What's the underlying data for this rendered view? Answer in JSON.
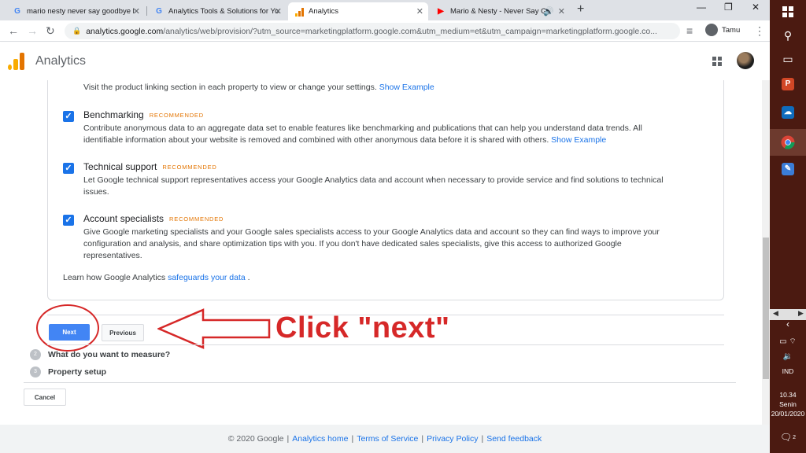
{
  "browser": {
    "tabs": [
      {
        "title": "mario nesty never say goodbye l",
        "favicon": "google-icon",
        "active": false
      },
      {
        "title": "Analytics Tools & Solutions for Yo",
        "favicon": "google-icon",
        "active": false
      },
      {
        "title": "Analytics",
        "favicon": "analytics-icon",
        "active": true
      },
      {
        "title": "Mario & Nesty - Never Say G",
        "favicon": "youtube-icon",
        "active": false
      }
    ],
    "new_tab": "+",
    "url_host": "analytics.google.com",
    "url_path": "/analytics/web/provision/?utm_source=marketingplatform.google.com&utm_medium=et&utm_campaign=marketingplatform.google.co...",
    "profile_name": "Tamu"
  },
  "header": {
    "title": "Analytics"
  },
  "settings": {
    "linking_desc": "Visit the product linking section in each property to view or change your settings.",
    "show_example": "Show Example",
    "options": [
      {
        "title": "Benchmarking",
        "badge": "RECOMMENDED",
        "desc": "Contribute anonymous data to an aggregate data set to enable features like benchmarking and publications that can help you understand data trends. All identifiable information about your website is removed and combined with other anonymous data before it is shared with others.",
        "link": "Show Example",
        "checked": true
      },
      {
        "title": "Technical support",
        "badge": "RECOMMENDED",
        "desc": "Let Google technical support representatives access your Google Analytics data and account when necessary to provide service and find solutions to technical issues.",
        "link": "",
        "checked": true
      },
      {
        "title": "Account specialists",
        "badge": "RECOMMENDED",
        "desc": "Give Google marketing specialists and your Google sales specialists access to your Google Analytics data and account so they can find ways to improve your configuration and analysis, and share optimization tips with you. If you don't have dedicated sales specialists, give this access to authorized Google representatives.",
        "link": "",
        "checked": true
      }
    ],
    "learn_prefix": "Learn how Google Analytics",
    "learn_link": "safeguards your data",
    "learn_suffix": "."
  },
  "buttons": {
    "next": "Next",
    "previous": "Previous",
    "cancel": "Cancel"
  },
  "annotation": {
    "text": "Click \"next\"",
    "color": "#d62828"
  },
  "steps": [
    {
      "num": "2",
      "label": "What do you want to measure?"
    },
    {
      "num": "3",
      "label": "Property setup"
    }
  ],
  "footer": {
    "copyright": "© 2020 Google",
    "links": [
      "Analytics home",
      "Terms of Service",
      "Privacy Policy",
      "Send feedback"
    ]
  },
  "taskbar": {
    "language": "IND",
    "time": "10.34",
    "day": "Senin",
    "date": "20/01/2020",
    "notification_count": "2"
  },
  "colors": {
    "accent": "#1a73e8",
    "next_button": "#4285f4",
    "recommended": "#e37400",
    "taskbar": "#4b1a11"
  }
}
